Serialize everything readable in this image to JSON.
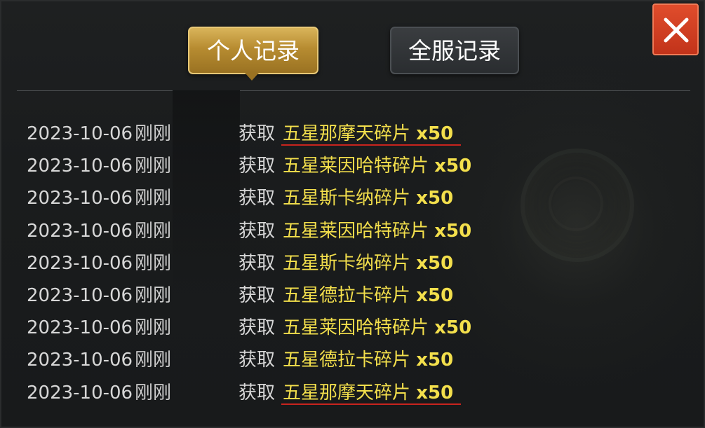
{
  "tabs": {
    "personal": "个人记录",
    "server": "全服记录"
  },
  "colors": {
    "item_text": "#f3df4c",
    "highlight_underline": "#c8241e",
    "active_tab": "#b78c31",
    "close_button": "#d0391f"
  },
  "icons": {
    "close": "close-x-icon"
  },
  "records": [
    {
      "date": "2023-10-06",
      "time": "刚刚",
      "action": "获取",
      "item": "五星那摩天碎片",
      "qty": "x50",
      "underlined": true
    },
    {
      "date": "2023-10-06",
      "time": "刚刚",
      "action": "获取",
      "item": "五星莱因哈特碎片",
      "qty": "x50",
      "underlined": false
    },
    {
      "date": "2023-10-06",
      "time": "刚刚",
      "action": "获取",
      "item": "五星斯卡纳碎片",
      "qty": "x50",
      "underlined": false
    },
    {
      "date": "2023-10-06",
      "time": "刚刚",
      "action": "获取",
      "item": "五星莱因哈特碎片",
      "qty": "x50",
      "underlined": false
    },
    {
      "date": "2023-10-06",
      "time": "刚刚",
      "action": "获取",
      "item": "五星斯卡纳碎片",
      "qty": "x50",
      "underlined": false
    },
    {
      "date": "2023-10-06",
      "time": "刚刚",
      "action": "获取",
      "item": "五星德拉卡碎片",
      "qty": "x50",
      "underlined": false
    },
    {
      "date": "2023-10-06",
      "time": "刚刚",
      "action": "获取",
      "item": "五星莱因哈特碎片",
      "qty": "x50",
      "underlined": false
    },
    {
      "date": "2023-10-06",
      "time": "刚刚",
      "action": "获取",
      "item": "五星德拉卡碎片",
      "qty": "x50",
      "underlined": false
    },
    {
      "date": "2023-10-06",
      "time": "刚刚",
      "action": "获取",
      "item": "五星那摩天碎片",
      "qty": "x50",
      "underlined": true
    }
  ]
}
